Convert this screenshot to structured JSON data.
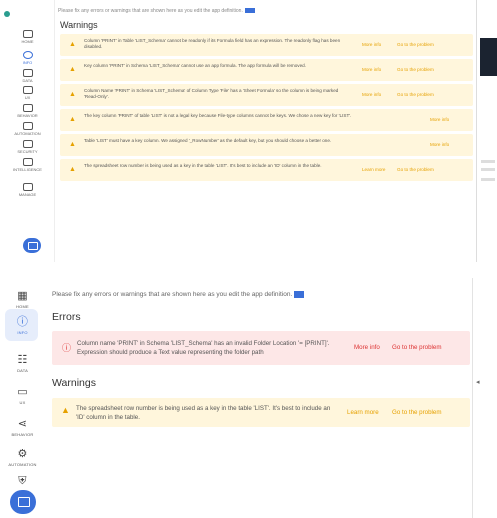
{
  "top": {
    "brand": "",
    "nav": [
      {
        "label": "HOME",
        "active": false
      },
      {
        "label": "INFO",
        "active": true
      },
      {
        "label": "DATA",
        "active": false
      },
      {
        "label": "UX",
        "active": false
      },
      {
        "label": "BEHAVIOR",
        "active": false
      },
      {
        "label": "AUTOMATION",
        "active": false
      },
      {
        "label": "SECURITY",
        "active": false
      },
      {
        "label": "INTELLIGENCE",
        "active": false
      },
      {
        "label": "MANAGE",
        "active": false
      }
    ],
    "notice": "Please fix any errors or warnings that are shown here as you edit the app definition.",
    "warnings_heading": "Warnings",
    "warnings": [
      {
        "text": "Column 'PRINT' in Table 'LIST_Schema' cannot be readonly if its Formula field has an expression. The readonly flag has been disabled.",
        "more_info": "More info",
        "goto": "Go to the problem"
      },
      {
        "text": "Key column 'PRINT' in Schema 'LIST_Schema' cannot use an app formula. The app formula will be removed.",
        "more_info": "More info",
        "goto": "Go to the problem"
      },
      {
        "text": "Column Name 'PRINT' in Schema 'LIST_Schema' of Column Type 'File' has a 'Sheet Formula' so the column is being marked 'Read-Only'.",
        "more_info": "More info",
        "goto": "Go to the problem"
      },
      {
        "text": "The key column 'PRINT' of table 'LIST' is not a legal key because File-type columns cannot be keys. We chose a new key for 'LIST'.",
        "more_info": "More info",
        "goto": ""
      },
      {
        "text": "Table 'LIST' must have a key column. We assigned '_RowNumber' as the default key, but you should choose a better one.",
        "more_info": "More info",
        "goto": ""
      },
      {
        "text": "The spreadsheet row number is being used as a key in the table 'LIST'. It's best to include an 'ID' column in the table.",
        "more_info": "Learn more",
        "goto": "Go to the problem"
      }
    ]
  },
  "bottom": {
    "nav": [
      {
        "label": "HOME",
        "icon": "grid-icon",
        "active": false
      },
      {
        "label": "INFO",
        "icon": "info-icon",
        "active": true
      },
      {
        "label": "DATA",
        "icon": "table-icon",
        "active": false
      },
      {
        "label": "UX",
        "icon": "screen-icon",
        "active": false
      },
      {
        "label": "BEHAVIOR",
        "icon": "share-icon",
        "active": false
      },
      {
        "label": "AUTOMATION",
        "icon": "robot-icon",
        "active": false
      },
      {
        "label": "SECURITY",
        "icon": "shield-icon",
        "active": false
      }
    ],
    "notice": "Please fix any errors or warnings that are shown here as you edit the app definition.",
    "errors_heading": "Errors",
    "error": {
      "text": "Column name 'PRINT' in Schema 'LIST_Schema' has an invalid Folder Location '= [PRINT]'. Expression should produce a Text value representing the folder path",
      "more_info": "More info",
      "goto": "Go to the problem"
    },
    "warnings_heading": "Warnings",
    "warning": {
      "text": "The spreadsheet row number is being used as a key in the table 'LIST'. It's best to include an 'ID' column in the table.",
      "more_info": "Learn more",
      "goto": "Go to the problem"
    }
  },
  "colors": {
    "accent": "#3a6fd8",
    "warning_bg": "#fff6dc",
    "warning_fg": "#e6a100",
    "error_bg": "#fde7e7",
    "error_fg": "#dd3333"
  }
}
